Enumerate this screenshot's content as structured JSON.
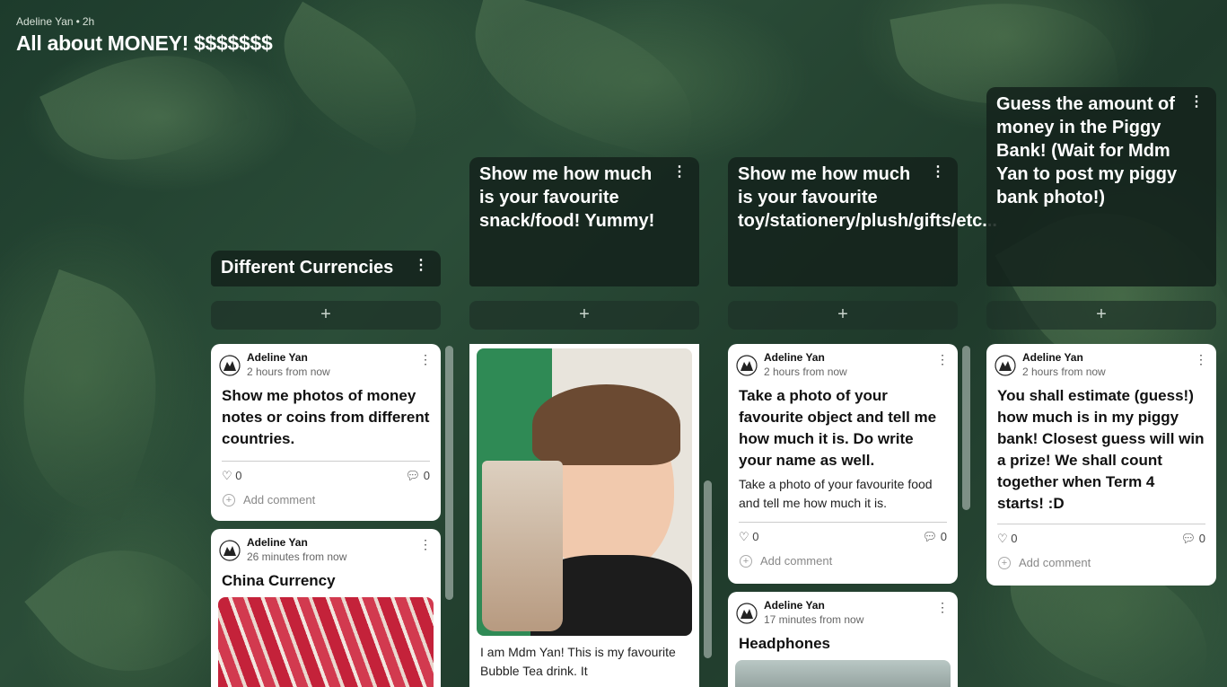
{
  "header": {
    "author": "Adeline Yan",
    "age": "2h",
    "title": "All about MONEY! $$$$$$$"
  },
  "columns": [
    {
      "title": "Different Currencies",
      "add_label": "+",
      "cards": [
        {
          "author": "Adeline Yan",
          "time": "2 hours from now",
          "subject": "Show me photos of money notes or coins from different countries.",
          "likes": "0",
          "comments": "0",
          "add_comment": "Add comment"
        },
        {
          "author": "Adeline Yan",
          "time": "26 minutes from now",
          "subject": "China Currency"
        }
      ]
    },
    {
      "title": "Show me how much is your favourite snack/food! Yummy!",
      "add_label": "+",
      "cards": [
        {
          "body": "I am Mdm Yan! This is my favourite Bubble Tea drink. It"
        }
      ]
    },
    {
      "title": "Show me how much is your favourite toy/stationery/plush/gifts/etc...",
      "add_label": "+",
      "cards": [
        {
          "author": "Adeline Yan",
          "time": "2 hours from now",
          "subject": "Take a photo of your favourite object and tell me how much it is. Do write your name as well.",
          "body": "Take a photo of your favourite food and tell me how much it is.",
          "likes": "0",
          "comments": "0",
          "add_comment": "Add comment"
        },
        {
          "author": "Adeline Yan",
          "time": "17 minutes from now",
          "subject": "Headphones"
        }
      ]
    },
    {
      "title": "Guess the amount of money in the Piggy Bank! (Wait for Mdm Yan to post my piggy bank photo!)",
      "add_label": "+",
      "cards": [
        {
          "author": "Adeline Yan",
          "time": "2 hours from now",
          "subject": "You shall estimate (guess!) how much is in my piggy bank! Closest guess will win a prize! We shall count together when Term 4 starts! :D",
          "likes": "0",
          "comments": "0",
          "add_comment": "Add comment"
        }
      ]
    }
  ],
  "icons": {
    "more": "more-vertical-icon",
    "heart": "heart-icon",
    "comment": "comment-icon",
    "plus": "plus-icon",
    "avatar": "avatar-icon"
  }
}
